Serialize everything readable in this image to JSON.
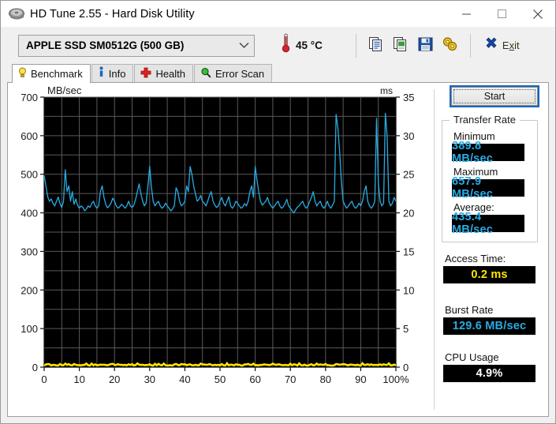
{
  "window": {
    "title": "HD Tune 2.55 - Hard Disk Utility",
    "icon": "hard-disk-icon",
    "minimize": "—",
    "maximize": "☐",
    "close": "✕"
  },
  "toolbar": {
    "drive": "APPLE  SSD SM0512G (500 GB)",
    "drive_caret": "⌄",
    "temperature": "45 °C",
    "thermometer_icon": "thermometer-icon",
    "buttons": [
      {
        "name": "copy-button",
        "icon": "copy-icon"
      },
      {
        "name": "copy-image-button",
        "icon": "copy-image-icon"
      },
      {
        "name": "save-button",
        "icon": "floppy-save-icon"
      },
      {
        "name": "options-button",
        "icon": "gears-options-icon"
      }
    ],
    "exit_label_prefix": "E",
    "exit_label_accel": "x",
    "exit_label_suffix": "it",
    "exit_icon": "close-x-icon"
  },
  "tabs": [
    {
      "label": "Benchmark",
      "icon": "lightbulb-icon",
      "active": true
    },
    {
      "label": "Info",
      "icon": "info-icon",
      "active": false
    },
    {
      "label": "Health",
      "icon": "red-cross-icon",
      "active": false
    },
    {
      "label": "Error Scan",
      "icon": "magnifier-icon",
      "active": false
    }
  ],
  "sidebar": {
    "start_button": "Start",
    "transfer_rate": {
      "group_title": "Transfer Rate",
      "minimum_label": "Minimum",
      "minimum_value": "389.8 MB/sec",
      "maximum_label": "Maximum",
      "maximum_value": "657.9 MB/sec",
      "average_label": "Average:",
      "average_value": "435.4 MB/sec"
    },
    "access_time_label": "Access Time:",
    "access_time_value": "0.2 ms",
    "burst_rate_label": "Burst Rate",
    "burst_rate_value": "129.6 MB/sec",
    "cpu_usage_label": "CPU Usage",
    "cpu_usage_value": "4.9%"
  },
  "colors": {
    "transfer_trace": "#29ace3",
    "access_trace": "#ffe500",
    "plot_background": "#000000",
    "gridline": "#5a5a5a",
    "lcd_background": "#000000",
    "focus_blue": "#1566c0",
    "temperature_red": "#d4232a"
  },
  "chart_data": {
    "type": "line",
    "title": "",
    "xlabel": "",
    "ylabel": "MB/sec",
    "y2label": "ms",
    "ylim": [
      0,
      700
    ],
    "y2lim": [
      0,
      35
    ],
    "xlim": [
      0,
      100
    ],
    "yticks": [
      0,
      100,
      200,
      300,
      400,
      500,
      600,
      700
    ],
    "y2ticks": [
      0,
      5,
      10,
      15,
      20,
      25,
      30,
      35
    ],
    "xticks": [
      0,
      10,
      20,
      30,
      40,
      50,
      60,
      70,
      80,
      90,
      100
    ],
    "xticklabels": [
      "0",
      "10",
      "20",
      "30",
      "40",
      "50",
      "60",
      "70",
      "80",
      "90",
      "100%"
    ],
    "grid": true,
    "grid_x_step": 5,
    "grid_y_step": 50,
    "legend": "none",
    "series": [
      {
        "name": "Transfer rate",
        "axis": "left",
        "unit": "MB/sec",
        "color": "#29ace3",
        "x": [
          0.0,
          0.5,
          1.0,
          1.5,
          2.0,
          2.5,
          3.0,
          3.5,
          4.0,
          4.5,
          5.0,
          5.5,
          6.0,
          6.5,
          7.0,
          7.5,
          8.0,
          8.5,
          9.0,
          9.5,
          10.0,
          10.5,
          11.0,
          11.5,
          12.0,
          12.5,
          13.0,
          13.5,
          14.0,
          14.5,
          15.0,
          15.5,
          16.0,
          16.5,
          17.0,
          17.5,
          18.0,
          18.5,
          19.0,
          19.5,
          20.0,
          20.5,
          21.0,
          21.5,
          22.0,
          22.5,
          23.0,
          23.5,
          24.0,
          24.5,
          25.0,
          25.5,
          26.0,
          26.5,
          27.0,
          27.5,
          28.0,
          28.5,
          29.0,
          29.5,
          30.0,
          30.5,
          31.0,
          31.5,
          32.0,
          32.5,
          33.0,
          33.5,
          34.0,
          34.5,
          35.0,
          35.5,
          36.0,
          36.5,
          37.0,
          37.5,
          38.0,
          38.5,
          39.0,
          39.5,
          40.0,
          40.5,
          41.0,
          41.5,
          42.0,
          42.5,
          43.0,
          43.5,
          44.0,
          44.5,
          45.0,
          45.5,
          46.0,
          46.5,
          47.0,
          47.5,
          48.0,
          48.5,
          49.0,
          49.5,
          50.0,
          50.5,
          51.0,
          51.5,
          52.0,
          52.5,
          53.0,
          53.5,
          54.0,
          54.5,
          55.0,
          55.5,
          56.0,
          56.5,
          57.0,
          57.5,
          58.0,
          58.5,
          59.0,
          59.5,
          60.0,
          60.5,
          61.0,
          61.5,
          62.0,
          62.5,
          63.0,
          63.5,
          64.0,
          64.5,
          65.0,
          65.5,
          66.0,
          66.5,
          67.0,
          67.5,
          68.0,
          68.5,
          69.0,
          69.5,
          70.0,
          70.5,
          71.0,
          71.5,
          72.0,
          72.5,
          73.0,
          73.5,
          74.0,
          74.5,
          75.0,
          75.5,
          76.0,
          76.5,
          77.0,
          77.5,
          78.0,
          78.5,
          79.0,
          79.5,
          80.0,
          80.5,
          81.0,
          81.5,
          82.0,
          82.5,
          83.0,
          83.5,
          84.0,
          84.5,
          85.0,
          85.5,
          86.0,
          86.5,
          87.0,
          87.5,
          88.0,
          88.5,
          89.0,
          89.5,
          90.0,
          90.5,
          91.0,
          91.5,
          92.0,
          92.5,
          93.0,
          93.5,
          94.0,
          94.5,
          95.0,
          95.5,
          96.0,
          96.5,
          97.0,
          97.5,
          98.0,
          98.5,
          99.0,
          99.5,
          100.0
        ],
        "y": [
          497,
          470,
          442,
          430,
          436,
          425,
          418,
          430,
          441,
          424,
          414,
          430,
          512,
          455,
          470,
          430,
          455,
          422,
          436,
          420,
          412,
          418,
          414,
          405,
          410,
          418,
          414,
          424,
          430,
          418,
          412,
          418,
          455,
          470,
          440,
          422,
          413,
          418,
          425,
          438,
          430,
          418,
          412,
          416,
          422,
          418,
          412,
          418,
          430,
          418,
          414,
          420,
          435,
          455,
          475,
          450,
          430,
          418,
          426,
          470,
          520,
          466,
          430,
          418,
          425,
          430,
          418,
          412,
          416,
          425,
          418,
          412,
          405,
          410,
          418,
          465,
          455,
          430,
          418,
          422,
          430,
          470,
          455,
          520,
          500,
          470,
          450,
          430,
          435,
          445,
          430,
          425,
          418,
          430,
          445,
          455,
          430,
          420,
          414,
          418,
          430,
          440,
          425,
          418,
          430,
          442,
          418,
          412,
          418,
          430,
          425,
          418,
          412,
          416,
          424,
          418,
          430,
          455,
          470,
          440,
          520,
          485,
          455,
          430,
          420,
          425,
          430,
          440,
          425,
          418,
          412,
          418,
          425,
          430,
          418,
          412,
          416,
          425,
          435,
          418,
          412,
          405,
          400,
          408,
          415,
          418,
          425,
          430,
          418,
          412,
          418,
          430,
          440,
          455,
          430,
          418,
          425,
          430,
          418,
          412,
          418,
          430,
          418,
          412,
          420,
          430,
          655,
          620,
          560,
          480,
          430,
          420,
          412,
          418,
          425,
          430,
          418,
          412,
          416,
          425,
          418,
          430,
          455,
          470,
          430,
          418,
          412,
          418,
          430,
          645,
          480,
          430,
          418,
          425,
          658,
          600,
          430,
          418,
          425,
          440,
          430,
          418,
          412,
          418,
          430,
          455,
          430,
          418,
          425,
          430,
          425
        ]
      },
      {
        "name": "Access time",
        "axis": "right",
        "unit": "ms",
        "color": "#ffe500",
        "approx_value": 0.2,
        "note": "flat trace along 0 ms baseline across full 0-100% span"
      }
    ]
  }
}
